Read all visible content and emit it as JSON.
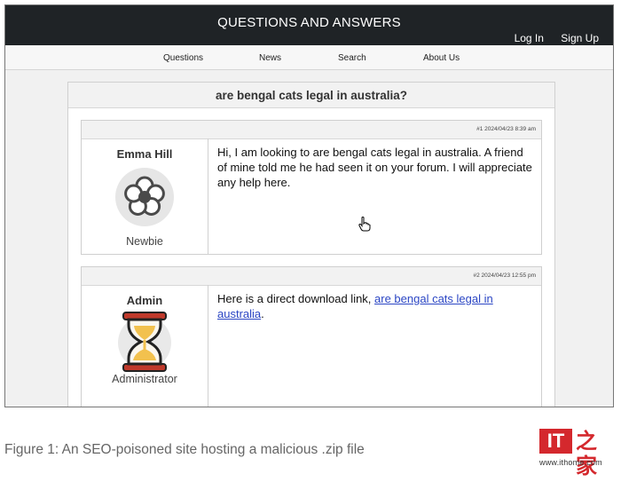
{
  "header": {
    "site_title": "QUESTIONS AND ANSWERS",
    "login": "Log In",
    "signup": "Sign Up"
  },
  "nav": {
    "questions": "Questions",
    "news": "News",
    "search": "Search",
    "about": "About Us"
  },
  "question": {
    "title": "are bengal cats legal in australia?"
  },
  "posts": [
    {
      "meta": "#1 2024/04/23 8:39 am",
      "author": "Emma Hill",
      "role": "Newbie",
      "avatar_icon": "flower-icon",
      "text": "Hi, I am looking to are bengal cats legal in australia. A friend of mine told me he had seen it on your forum. I will appreciate any help here."
    },
    {
      "meta": "#2 2024/04/23 12:55 pm",
      "author": "Admin",
      "role": "Administrator",
      "avatar_icon": "hourglass-icon",
      "text_before": "Here is a direct download link, ",
      "link_text": "are bengal cats legal in australia",
      "text_after": "."
    }
  ],
  "caption": "Figure 1: An SEO-poisoned site hosting a malicious .zip file",
  "watermark": {
    "logo_text": "IT",
    "logo_glyph": "之家",
    "url": "www.ithome.com"
  },
  "colors": {
    "topbar": "#1f2326",
    "link": "#2b46c4",
    "logo_red": "#d4282d"
  }
}
